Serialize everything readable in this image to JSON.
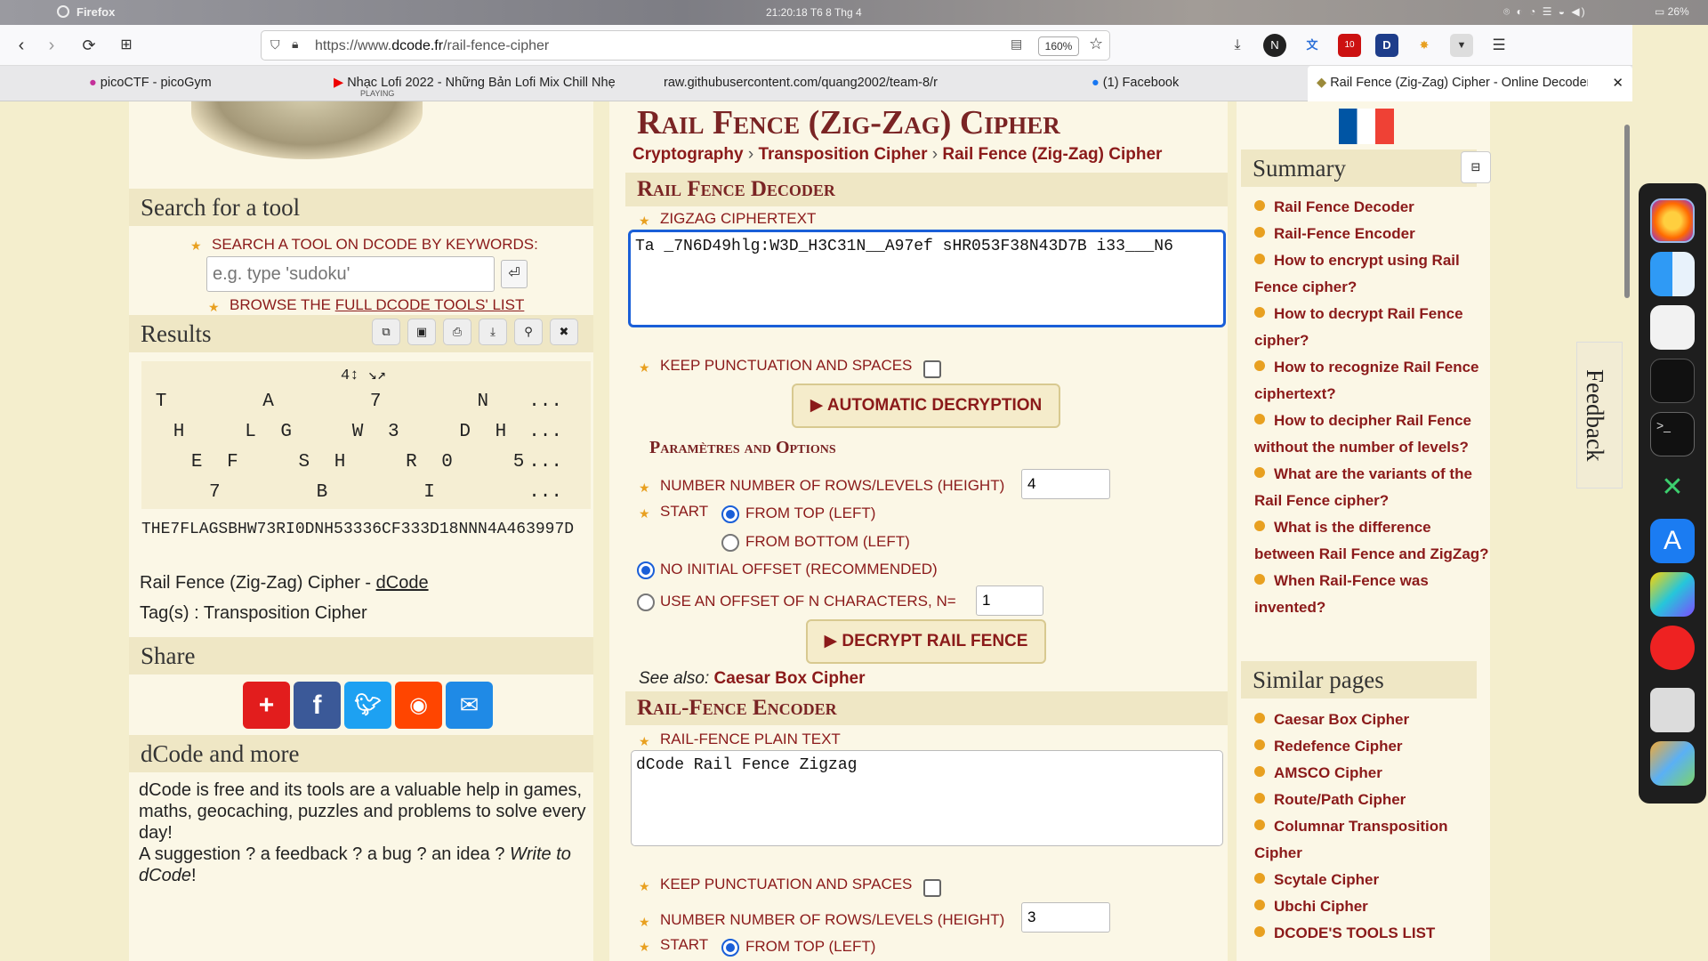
{
  "system": {
    "app": "Firefox",
    "clock": "21:20:18  T6 8 Thg 4",
    "tray": "⌾  ◐  ◔  ☰  ◒  ◀)",
    "battery": "▭ 26%"
  },
  "browser": {
    "url_prefix": "https://www.",
    "url_host": "dcode.fr",
    "url_path": "/rail-fence-cipher",
    "zoom": "160%",
    "tabs": [
      {
        "title": "picoCTF - picoGym",
        "sub": ""
      },
      {
        "title": "Nhạc Lofi 2022 - Những Bản Lofi Mix Chill Nhẹ",
        "sub": "PLAYING"
      },
      {
        "title": "raw.githubusercontent.com/quang2002/team-8/r",
        "sub": ""
      },
      {
        "title": "(1) Facebook",
        "sub": ""
      },
      {
        "title": "Rail Fence (Zig-Zag) Cipher - Online Decoder",
        "sub": ""
      }
    ],
    "toolbar_badges": {
      "n": "N",
      "d": "D",
      "ext_count": "10"
    }
  },
  "left": {
    "search_header": "Search for a tool",
    "search_label": "SEARCH A TOOL ON DCODE BY KEYWORDS:",
    "search_placeholder": "e.g. type 'sudoku'",
    "browse_prefix": "BROWSE THE ",
    "browse_link": "FULL DCODE TOOLS' LIST",
    "results_header": "Results",
    "rail_controls": "4↕  ↘↗",
    "rails": [
      [
        "T",
        "",
        "",
        "",
        "",
        "",
        "A",
        "",
        "",
        "",
        "",
        "",
        "7",
        "",
        "",
        "",
        "",
        "",
        "N",
        "",
        "",
        "..."
      ],
      [
        "",
        "H",
        "",
        "",
        "",
        "L",
        "",
        "G",
        "",
        "",
        "",
        "W",
        "",
        "3",
        "",
        "",
        "",
        "D",
        "",
        "H",
        "",
        "..."
      ],
      [
        "",
        "",
        "E",
        "",
        "F",
        "",
        "",
        "",
        "S",
        "",
        "H",
        "",
        "",
        "",
        "R",
        "",
        "0",
        "",
        "",
        "",
        "5",
        "..."
      ],
      [
        "",
        "",
        "",
        "7",
        "",
        "",
        "",
        "",
        "",
        "B",
        "",
        "",
        "",
        "",
        "",
        "I",
        "",
        "",
        "",
        "",
        "",
        "..."
      ]
    ],
    "result_text": "THE7FLAGSBHW73RI0DNH53336CF333D18NNN4A463997D",
    "cite_prefix": "Rail Fence (Zig-Zag) Cipher - ",
    "cite_link": "dCode",
    "tags": "Tag(s) : Transposition Cipher",
    "share_header": "Share",
    "more_header": "dCode and more",
    "more_text_1": "dCode is free and its tools are a valuable help in games, maths, geocaching, puzzles and problems to solve every day!",
    "more_text_2": "A suggestion ? a feedback ? a bug ? an idea ? ",
    "more_text_em": "Write to dCode",
    "more_text_end": "!"
  },
  "main": {
    "title": "Rail Fence (Zig-Zag) Cipher",
    "breadcrumb": [
      "Cryptography",
      "Transposition Cipher",
      "Rail Fence (Zig-Zag) Cipher"
    ],
    "decoder_header": "Rail Fence Decoder",
    "ciphertext_label": "ZIGZAG CIPHERTEXT",
    "ciphertext_value": "Ta _7N6D49hlg:W3D_H3C31N__A97ef sHR053F38N43D7B i33___N6",
    "keep_punct": "KEEP PUNCTUATION AND SPACES",
    "auto_btn": "▶ AUTOMATIC DECRYPTION",
    "params_header": "Paramètres and Options",
    "rows_label": "NUMBER NUMBER OF ROWS/LEVELS (HEIGHT)",
    "rows_value": "4",
    "start_label": "START",
    "from_top": "FROM TOP (LEFT)",
    "from_bottom": "FROM BOTTOM (LEFT)",
    "no_offset": "NO INITIAL OFFSET (RECOMMENDED)",
    "use_offset": "USE AN OFFSET OF N CHARACTERS, N=",
    "offset_value": "1",
    "decrypt_btn": "▶ DECRYPT RAIL FENCE",
    "see_also_prefix": "See also: ",
    "see_also_link": "Caesar Box Cipher",
    "encoder_header": "Rail-Fence Encoder",
    "plain_label": "RAIL-FENCE PLAIN TEXT",
    "plain_value": "dCode Rail Fence Zigzag",
    "enc_keep_punct": "KEEP PUNCTUATION AND SPACES",
    "enc_rows_label": "NUMBER NUMBER OF ROWS/LEVELS (HEIGHT)",
    "enc_rows_value": "3",
    "enc_start_label": "START",
    "enc_from_top": "FROM TOP (LEFT)"
  },
  "right": {
    "summary_header": "Summary",
    "summary_items": [
      "Rail Fence Decoder",
      "Rail-Fence Encoder",
      "How to encrypt using Rail Fence cipher?",
      "How to decrypt Rail Fence cipher?",
      "How to recognize Rail Fence ciphertext?",
      "How to decipher Rail Fence without the number of levels?",
      "What are the variants of the Rail Fence cipher?",
      "What is the difference between Rail Fence and ZigZag?",
      "When Rail-Fence was invented?"
    ],
    "similar_header": "Similar pages",
    "similar_items": [
      "Caesar Box Cipher",
      "Redefence Cipher",
      "AMSCO Cipher",
      "Route/Path Cipher",
      "Columnar Transposition Cipher",
      "Scytale Cipher",
      "Ubchi Cipher",
      "DCODE'S TOOLS LIST"
    ],
    "feedback": "Feedback"
  },
  "colors": {
    "accent": "#8b1a1a",
    "heading": "#7a2424",
    "star": "#e8a020",
    "focus": "#1a5fd8"
  }
}
